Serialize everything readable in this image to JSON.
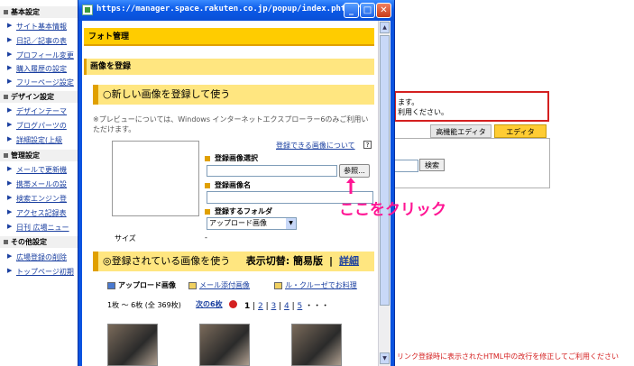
{
  "sidebar": {
    "sections": [
      {
        "title": "基本設定",
        "items": [
          "サイト基本情報",
          "日記／記事の表",
          "プロフィール変更",
          "購入履歴の設定",
          "フリーページ設定"
        ]
      },
      {
        "title": "デザイン設定",
        "items": [
          "デザインテーマ",
          "ブログパーツの",
          "詳細設定(上級"
        ]
      },
      {
        "title": "管理設定",
        "items": [
          "メールで更新機",
          "携帯メールの設",
          "検索エンジン登",
          "アクセス記録表",
          "日刊 広場ニュー"
        ]
      },
      {
        "title": "その他設定",
        "items": [
          "広場登録の削除",
          "トップページ初期"
        ]
      }
    ]
  },
  "background": {
    "error_line1": "ます。",
    "error_line2": "利用ください。",
    "tab_advanced": "高機能エディタ",
    "tab_editor": "エディタ",
    "search_button": "検索",
    "bottom_notice": "リンク登録時に表示されたHTML中の改行を修正してご利用ください"
  },
  "popup": {
    "title": "https://manager.space.rakuten.co.jp/popup/index.phtml?me...",
    "header_main": "フォト管理",
    "header_register": "画像を登録",
    "option_new": "○新しい画像を登録して使う",
    "note": "※プレビューについては、Windows インターネットエクスプローラー6のみご利用いただけます。",
    "registrable_link": "登録できる画像について",
    "help": "?",
    "label_file": "登録画像選択",
    "browse_button": "参照...",
    "label_name": "登録画像名",
    "label_folder": "登録するフォルダ",
    "folder_value": "アップロード画像",
    "size_label": "サイズ",
    "size_value": "-",
    "option_existing_prefix": "◎登録されている画像を使う",
    "display_toggle": "表示切替: 簡易版",
    "display_sep": "|",
    "display_link": "詳細",
    "folder_tabs": [
      "アップロード画像",
      "メール添付画像",
      "ル・クルーゼでお料理"
    ],
    "count_text": "1枚 ～ 6枚 (全 369枚)",
    "next_label": "次の6枚",
    "pages_current": "1",
    "pages": [
      "2",
      "3",
      "4",
      "5"
    ],
    "pages_more": "・・・"
  },
  "annotation": {
    "click_here": "ここをクリック",
    "color": "#ff1493"
  }
}
